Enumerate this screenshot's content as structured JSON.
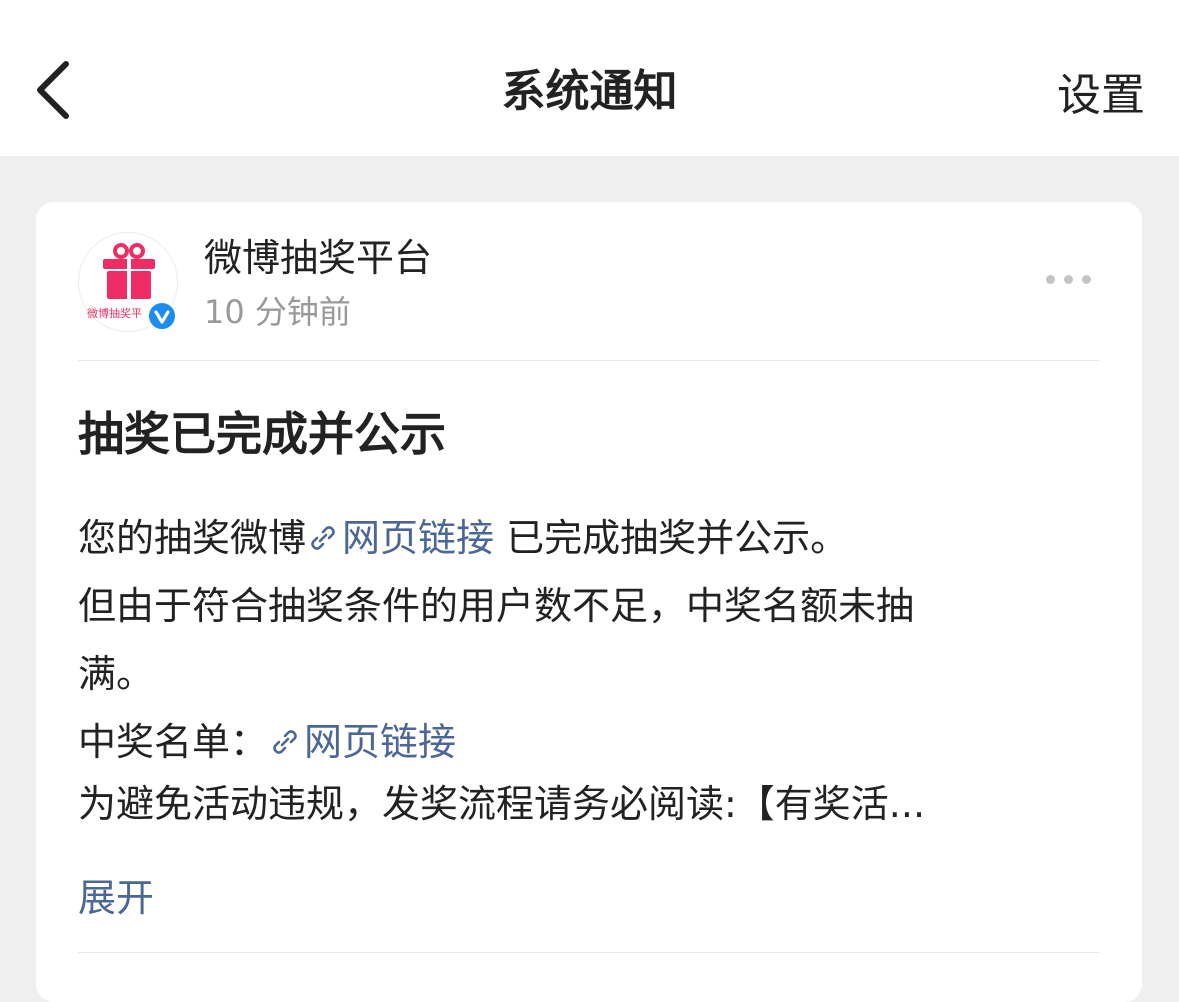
{
  "nav": {
    "title": "系统通知",
    "settings_label": "设置"
  },
  "message": {
    "sender_name": "微博抽奖平台",
    "avatar_text": "微博抽奖平",
    "time": "10 分钟前",
    "title": "抽奖已完成并公示",
    "line1_prefix": "您的抽奖微博",
    "link1_label": "网页链接",
    "line1_suffix": " 已完成抽奖并公示。",
    "line2": "但由于符合抽奖条件的用户数不足，中奖名额未抽",
    "line3": "满。",
    "line4_prefix": "中奖名单：",
    "link2_label": "网页链接",
    "line5": "为避免活动违规，发奖流程请务必阅读:【有奖活...",
    "expand_label": "展开"
  },
  "colors": {
    "link": "#4b6795",
    "background": "#efefef",
    "verified": "#1d8cf0",
    "brand": "#e8335f"
  },
  "icons": {
    "back": "chevron-left-icon",
    "more": "more-dots-icon",
    "link": "link-icon",
    "verified": "verified-badge-icon",
    "gift": "gift-icon"
  }
}
